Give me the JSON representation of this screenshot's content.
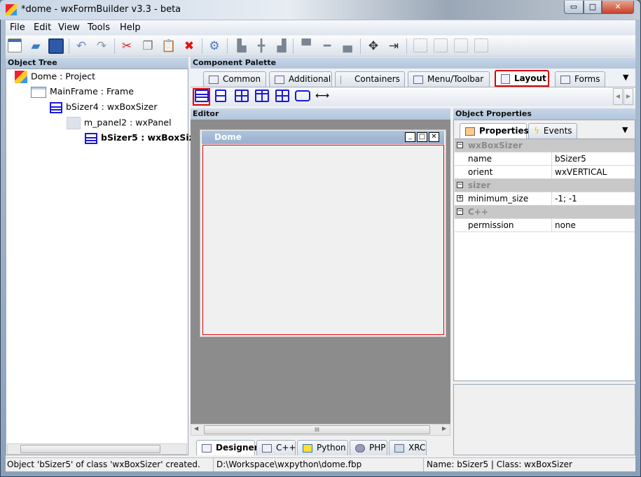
{
  "window": {
    "title": "*dome - wxFormBuilder v3.3 - beta",
    "minimize": "▭",
    "maximize": "□",
    "close": "✕"
  },
  "menu": [
    "File",
    "Edit",
    "View",
    "Tools",
    "Help"
  ],
  "toolbar": [
    "new-icon",
    "open-icon",
    "save-icon",
    "undo-icon",
    "redo-icon",
    "cut-icon",
    "copy-icon",
    "paste-icon",
    "delete-icon",
    "generate-code-icon",
    "align-left-icon",
    "align-center-icon",
    "align-right-icon",
    "align-top-icon",
    "align-middle-icon",
    "align-bottom-icon",
    "expand-icon",
    "stretch-icon",
    "border-left-icon",
    "border-right-icon",
    "border-top-icon",
    "border-bottom-icon"
  ],
  "object_tree": {
    "header": "Object Tree",
    "items": [
      {
        "label": "Dome : Project",
        "selected": false
      },
      {
        "label": "MainFrame : Frame",
        "selected": false
      },
      {
        "label": "bSizer4 : wxBoxSizer",
        "selected": false
      },
      {
        "label": "m_panel2 : wxPanel",
        "selected": false
      },
      {
        "label": "bSizer5 : wxBoxSizer",
        "selected": true
      }
    ]
  },
  "palette": {
    "header": "Component Palette",
    "tabs": [
      "Common",
      "Additional",
      "Containers",
      "Menu/Toolbar",
      "Layout",
      "Forms"
    ],
    "active_tab": "Layout",
    "tools": [
      "wxBoxSizer",
      "wxWrapSizer",
      "wxStaticBoxSizer",
      "wxGridSizer",
      "wxFlexGridSizer",
      "wxGridBagSizer",
      "spacer"
    ],
    "highlight_color": "#e00000"
  },
  "editor": {
    "header": "Editor",
    "frame_title": "Dome",
    "tabs": [
      "Designer",
      "C++",
      "Python",
      "PHP",
      "XRC"
    ],
    "active_tab": "Designer",
    "scroll_grip": "III"
  },
  "properties": {
    "header": "Object Properties",
    "tabs": [
      "Properties",
      "Events"
    ],
    "active_tab": "Properties",
    "rows": [
      {
        "category": "wxBoxSizer"
      },
      {
        "name": "name",
        "value": "bSizer5"
      },
      {
        "name": "orient",
        "value": "wxVERTICAL"
      },
      {
        "category": "sizer"
      },
      {
        "name": "minimum_size",
        "value": "-1; -1",
        "expandable": true
      },
      {
        "category": "C++"
      },
      {
        "name": "permission",
        "value": "none"
      }
    ]
  },
  "status": {
    "message": "Object 'bSizer5' of class 'wxBoxSizer' created.",
    "file": "D:\\Workspace\\wxpython\\dome.fbp",
    "selection": "Name: bSizer5 | Class: wxBoxSizer"
  }
}
